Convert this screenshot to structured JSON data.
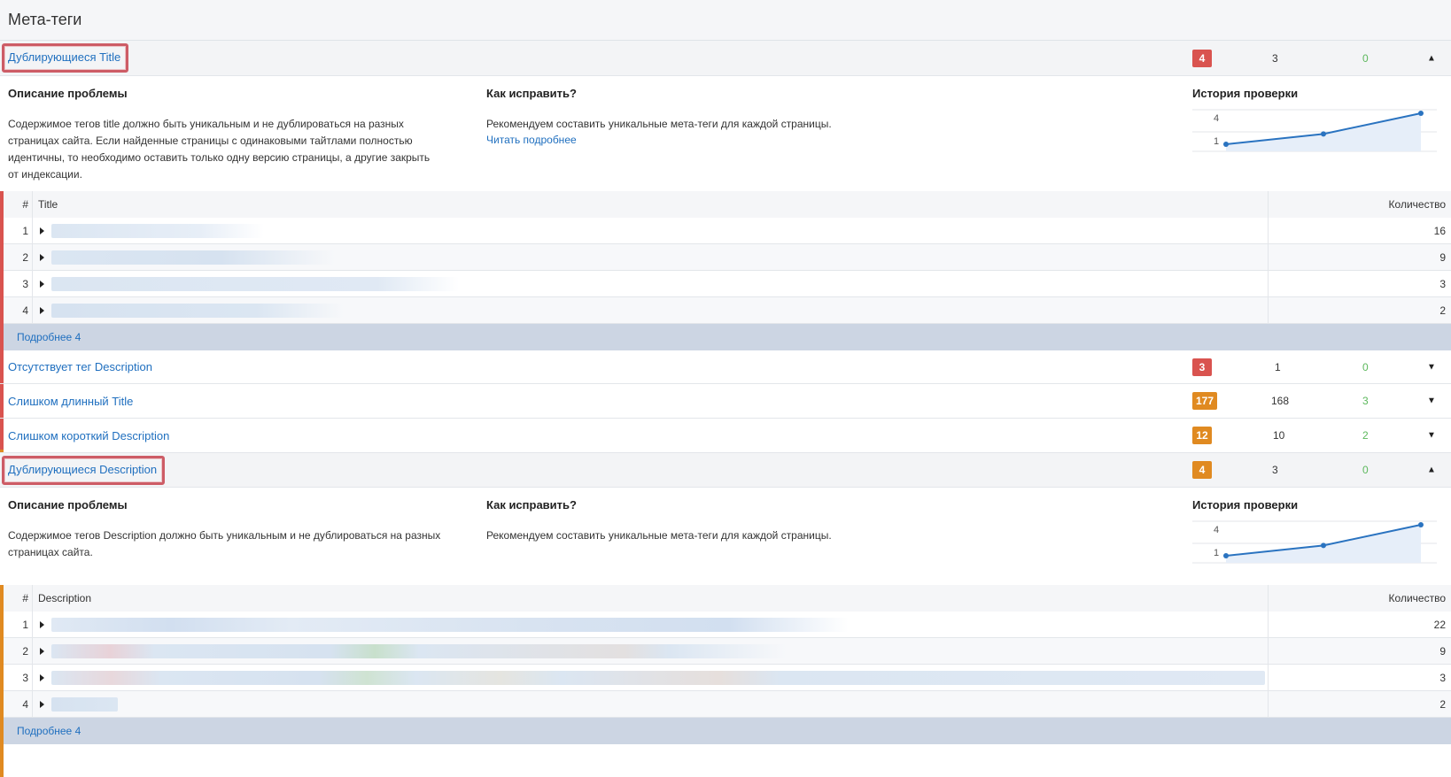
{
  "page": {
    "title": "Мета-теги"
  },
  "colors": {
    "bar_red": "#d9534f",
    "bar_orange": "#e08a21",
    "link": "#1f6fbf",
    "green": "#5cb85c",
    "chart": "#2a73c0"
  },
  "issues": [
    {
      "title": "Дублирующиеся Title",
      "badge": "4",
      "count": "3",
      "fixed": "0",
      "chevron": "▲",
      "expanded": true,
      "description_heading": "Описание проблемы",
      "description_lines": [
        "Содержимое тегов title должно быть уникальным и не дублироваться на разных",
        "страницах сайта. Если найденные страницы с одинаковыми тайтлами полностью",
        "идентичны, то необходимо оставить только одну версию страницы, а другие закрыть",
        "от индексации."
      ],
      "fix_heading": "Как исправить?",
      "fix_text": "Рекомендуем составить уникальные мета-теги для каждой страницы.",
      "fix_link": "Читать подробнее",
      "history_heading": "История проверки",
      "history_labels": [
        "4",
        "1"
      ],
      "history_points": [
        1,
        2,
        4
      ],
      "table": {
        "col_num": "#",
        "col_text": "Title",
        "col_qty": "Количество",
        "rows": [
          {
            "num": "1",
            "qty": "16"
          },
          {
            "num": "2",
            "qty": "9"
          },
          {
            "num": "3",
            "qty": "3"
          },
          {
            "num": "4",
            "qty": "2"
          }
        ]
      },
      "more": "Подробнее 4"
    },
    {
      "title": "Отсутствует тег Description",
      "badge": "3",
      "count": "1",
      "fixed": "0",
      "chevron": "▼"
    },
    {
      "title": "Слишком длинный Title",
      "badge": "177",
      "count": "168",
      "fixed": "3",
      "chevron": "▼"
    },
    {
      "title": "Слишком короткий Description",
      "badge": "12",
      "count": "10",
      "fixed": "2",
      "chevron": "▼"
    },
    {
      "title": "Дублирующиеся Description",
      "badge": "4",
      "count": "3",
      "fixed": "0",
      "chevron": "▲",
      "expanded": true,
      "description_heading": "Описание проблемы",
      "description_lines": [
        "Содержимое тегов Description должно быть уникальным и не дублироваться на разных",
        "страницах сайта."
      ],
      "fix_heading": "Как исправить?",
      "fix_text": "Рекомендуем составить уникальные мета-теги для каждой страницы.",
      "history_heading": "История проверки",
      "history_labels": [
        "4",
        "1"
      ],
      "history_points": [
        1,
        2,
        4
      ],
      "table": {
        "col_num": "#",
        "col_text": "Description",
        "col_qty": "Количество",
        "rows": [
          {
            "num": "1",
            "qty": "22"
          },
          {
            "num": "2",
            "qty": "9"
          },
          {
            "num": "3",
            "qty": "3"
          },
          {
            "num": "4",
            "qty": "2"
          }
        ]
      },
      "more": "Подробнее 4"
    }
  ]
}
